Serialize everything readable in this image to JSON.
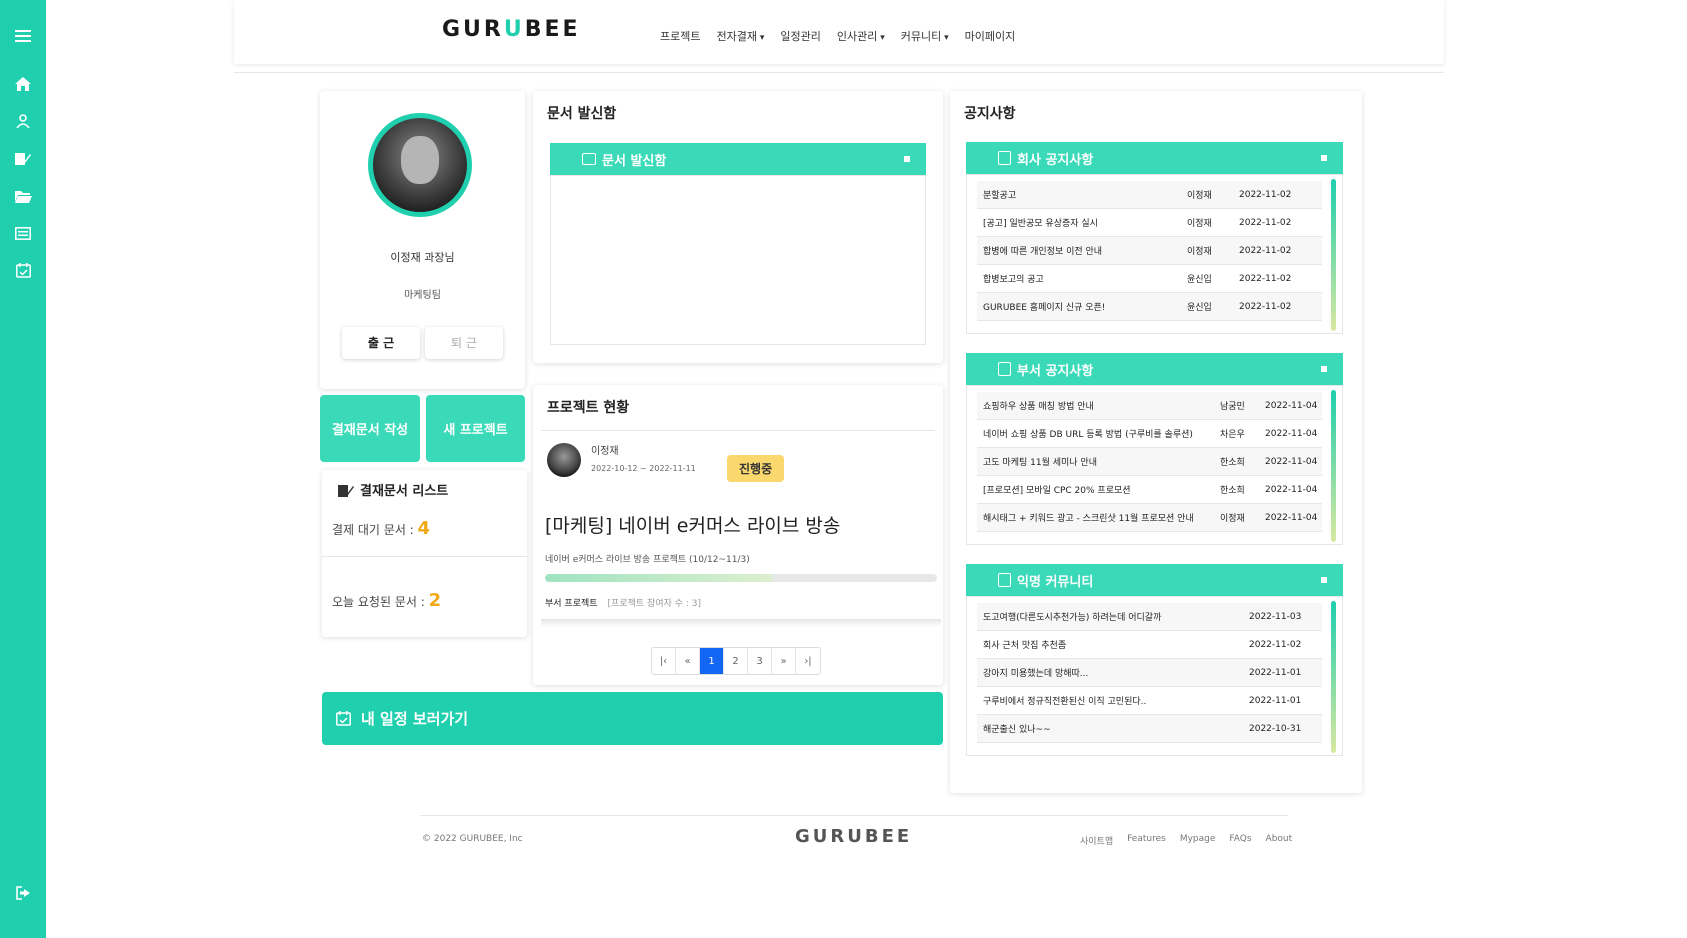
{
  "brand": {
    "logo_pre": "GUR",
    "logo_u": "U",
    "logo_post": "BEE"
  },
  "nav": {
    "items": [
      "프로젝트",
      "전자결재",
      "일정관리",
      "인사관리",
      "커뮤니티",
      "마이페이지"
    ]
  },
  "sidebar": {
    "icons": [
      "menu-icon",
      "home-icon",
      "user-icon",
      "edit-document-icon",
      "folder-open-icon",
      "list-icon",
      "calendar-check-icon",
      "logout-icon"
    ]
  },
  "profile": {
    "name": "이정재 과장님",
    "dept": "마케팅팀",
    "checkin_label": "출 근",
    "checkout_label": "퇴 근"
  },
  "actions": {
    "write_doc": "결재문서 작성",
    "new_project": "새 프로젝트"
  },
  "approval": {
    "title": "결재문서 리스트",
    "waiting_label": "결제 대기 문서 : ",
    "waiting_count": "4",
    "today_label": "오늘 요청된 문서 : ",
    "today_count": "2"
  },
  "outbox": {
    "section_title": "문서 발신함",
    "box_title": "문서 발신함"
  },
  "project": {
    "section_title": "프로젝트 현황",
    "owner": "이정재",
    "period": "2022-10-12 ~ 2022-11-11",
    "status": "진행중",
    "title": "[마케팅] 네이버 e커머스 라이브 방송",
    "desc": "네이버 e커머스 라이브 방송 프로젝트 (10/12~11/3)",
    "progress": 0.58,
    "type": "부서 프로젝트",
    "participants": "[프로젝트 참여자 수 : 3]",
    "pages": [
      "1",
      "2",
      "3"
    ],
    "active_page": "1"
  },
  "calendar_button": "내 일정 보러가기",
  "notices": {
    "section_title": "공지사항",
    "company": {
      "title": "회사 공지사항",
      "rows": [
        {
          "subject": "분할공고",
          "author": "이정재",
          "date": "2022-11-02"
        },
        {
          "subject": "[공고] 일반공모 유상증자 실시",
          "author": "이정재",
          "date": "2022-11-02"
        },
        {
          "subject": "합병에 따른 개인정보 이전 안내",
          "author": "이정재",
          "date": "2022-11-02"
        },
        {
          "subject": "합병보고의 공고",
          "author": "윤신입",
          "date": "2022-11-02"
        },
        {
          "subject": "GURUBEE 홈페이지 신규 오픈!",
          "author": "윤신입",
          "date": "2022-11-02"
        }
      ]
    },
    "department": {
      "title": "부서 공지사항",
      "rows": [
        {
          "subject": "쇼핑하우 상품 매칭 방법 안내",
          "author": "남궁민",
          "date": "2022-11-04"
        },
        {
          "subject": "네이버 쇼핑 상품 DB URL 등록 방법 (구루비를 솔루션)",
          "author": "차은우",
          "date": "2022-11-04"
        },
        {
          "subject": "고도 마케팅 11월 세미나 안내",
          "author": "한소희",
          "date": "2022-11-04"
        },
        {
          "subject": "[프로모션] 모바일 CPC 20% 프로모션",
          "author": "한소희",
          "date": "2022-11-04"
        },
        {
          "subject": "해시태그 + 키워드 광고 - 스크린샷 11월 프로모션 안내",
          "author": "이정재",
          "date": "2022-11-04"
        }
      ]
    },
    "community": {
      "title": "익명 커뮤니티",
      "rows": [
        {
          "subject": "도고여행(다른도시추천가능) 하려는데 어디갈까",
          "date": "2022-11-03"
        },
        {
          "subject": "회사 근처 맛집 추천좀",
          "date": "2022-11-02"
        },
        {
          "subject": "강아지 미용했는데 망해따...",
          "date": "2022-11-01"
        },
        {
          "subject": "구루비에서 정규직전환된신 이직 고민된다..",
          "date": "2022-11-01"
        },
        {
          "subject": "해군출신 있나~~",
          "date": "2022-10-31"
        }
      ]
    }
  },
  "footer": {
    "copyright": "© 2022 GURUBEE, Inc",
    "links": [
      "사이트맵",
      "Features",
      "Mypage",
      "FAQs",
      "About"
    ]
  },
  "colors": {
    "accent": "#1fcfad",
    "accent_light": "#3ad9b8",
    "badge": "#fbd86d",
    "count": "#f0a818",
    "pager_active": "#1266f1"
  }
}
